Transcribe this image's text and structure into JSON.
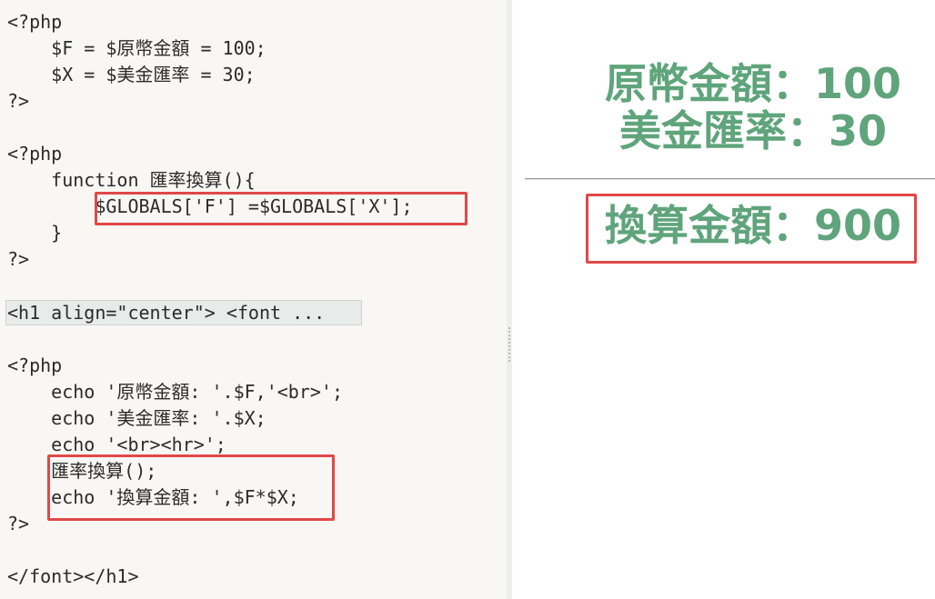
{
  "editor": {
    "lines": [
      "<?php",
      "    $F = $原幣金額 = 100;",
      "    $X = $美金匯率 = 30;",
      "?>",
      "",
      "<?php",
      "    function 匯率換算(){",
      "        $GLOBALS['F'] =$GLOBALS['X'];",
      "    }",
      "?>",
      "",
      "<h1 align=\"center\"> <font ...",
      "",
      "<?php",
      "    echo '原幣金額: '.$F,'<br>';",
      "    echo '美金匯率: '.$X;",
      "    echo '<br><hr>';",
      "    匯率換算();",
      "    echo '換算金額: ',$F*$X;",
      "?>",
      "",
      "</font></h1>"
    ]
  },
  "preview": {
    "line1": "原幣金額：100",
    "line2": "美金匯率：30",
    "result": "換算金額：900"
  },
  "colors": {
    "editor_bg": "#f8f7f3",
    "output_text": "#5fa47b",
    "highlight_border": "#e04848"
  }
}
